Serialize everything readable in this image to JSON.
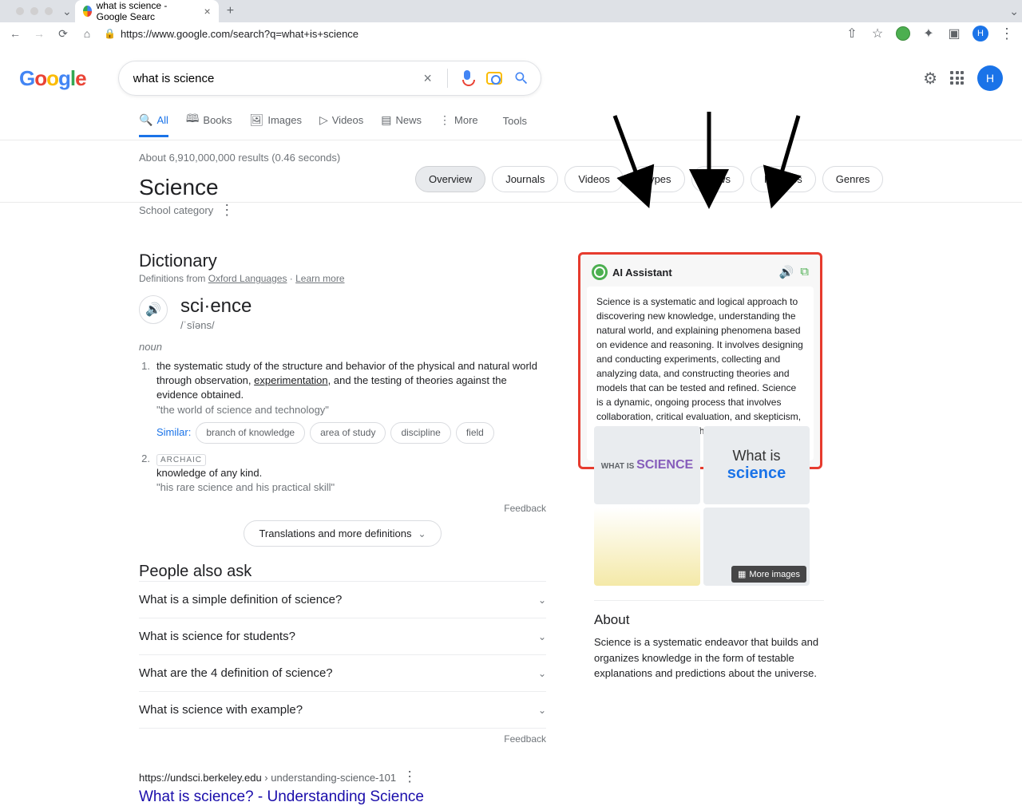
{
  "browser": {
    "tab_title": "what is science - Google Searc",
    "url": "https://www.google.com/search?q=what+is+science",
    "avatar_letter": "H"
  },
  "search": {
    "query": "what is science"
  },
  "tabs": {
    "all": "All",
    "books": "Books",
    "images": "Images",
    "videos": "Videos",
    "news": "News",
    "more": "More",
    "tools": "Tools"
  },
  "stats": "About 6,910,000,000 results (0.46 seconds)",
  "kp": {
    "title": "Science",
    "subtitle": "School category"
  },
  "pills": {
    "overview": "Overview",
    "journals": "Journals",
    "videos": "Videos",
    "types": "Types",
    "news": "News",
    "hobbies": "Hobbies",
    "genres": "Genres"
  },
  "dictionary": {
    "heading": "Dictionary",
    "source_prefix": "Definitions from ",
    "source_link": "Oxford Languages",
    "source_dot": " · ",
    "learn_more": "Learn more",
    "word": "sci·ence",
    "phonetic": "/ˈsīəns/",
    "pos": "noun",
    "def1": "the systematic study of the structure and behavior of the physical and natural world through observation, ",
    "def1_link": "experimentation",
    "def1_cont": ", and the testing of theories against the evidence obtained.",
    "def1_ex": "\"the world of science and technology\"",
    "similar_label": "Similar:",
    "chip1": "branch of knowledge",
    "chip2": "area of study",
    "chip3": "discipline",
    "chip4": "field",
    "archaic": "ARCHAIC",
    "def2": "knowledge of any kind.",
    "def2_ex": "\"his rare science and his practical skill\"",
    "feedback": "Feedback",
    "expand": "Translations and more definitions"
  },
  "paa": {
    "heading": "People also ask",
    "q1": "What is a simple definition of science?",
    "q2": "What is science for students?",
    "q3": "What are the 4 definition of science?",
    "q4": "What is science with example?",
    "feedback": "Feedback"
  },
  "result1": {
    "url": "https://undsci.berkeley.edu",
    "crumb": " › understanding-science-101",
    "title": "What is science? - Understanding Science"
  },
  "ai": {
    "title": "AI Assistant",
    "body": "Science is a systematic and logical approach to discovering new knowledge, understanding the natural world, and explaining phenomena based on evidence and reasoning. It involves designing and conducting experiments, collecting and analyzing data, and constructing theories and models that can be tested and refined. Science is a dynamic, ongoing process that involves collaboration, critical evaluation, and skepticism, and aims to uncover truth and advance human understanding."
  },
  "images": {
    "more": "More images",
    "cell1_a": "WHAT IS ",
    "cell1_b": "SCIENCE",
    "cell2_a": "What is",
    "cell2_b": "science"
  },
  "about": {
    "heading": "About",
    "body": "Science is a systematic endeavor that builds and organizes knowledge in the form of testable explanations and predictions about the universe."
  }
}
